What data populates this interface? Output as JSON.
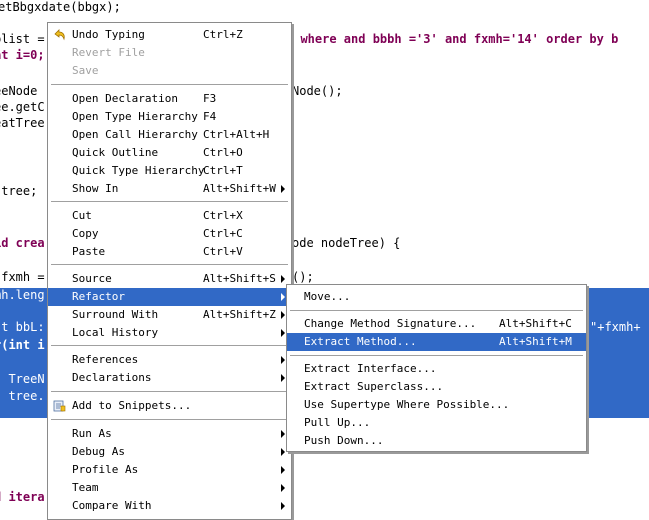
{
  "editor": {
    "lines": [
      {
        "text": "etBbgxdate(bbgx);",
        "sel": false
      },
      {
        "text": "blist = ",
        "sel": false
      },
      {
        "text": "  where and bbbh ='3' and fxmh='14' order by b",
        "sel": false
      },
      {
        "text": "at i=0;",
        "sel": false
      },
      {
        "text": "eeNode",
        "sel": false
      },
      {
        "text": "Node();",
        "sel": false
      },
      {
        "text": "ee.getC",
        "sel": false
      },
      {
        "text": "eatTree",
        "sel": false
      },
      {
        "text": " tree;",
        "sel": false
      },
      {
        "text": "id crea",
        "sel": false
      },
      {
        "text": "ode nodeTree) {",
        "sel": false
      },
      {
        "text": " fxmh =",
        "sel": false
      },
      {
        "text": "();",
        "sel": false
      },
      {
        "text": "mh.leng",
        "sel": true
      },
      {
        "text": "st bbL:",
        "sel": true
      },
      {
        "text": "\"+fxmh+",
        "sel": true
      },
      {
        "text": "r(int i",
        "sel": true
      },
      {
        "text": "  TreeN",
        "sel": true
      },
      {
        "text": "  tree.",
        "sel": true
      },
      {
        "text": "d itera",
        "sel": false
      }
    ]
  },
  "context_menu": {
    "groups": [
      [
        {
          "label": "Undo Typing",
          "accel": "Ctrl+Z",
          "enabled": true,
          "icon": "undo-icon"
        },
        {
          "label": "Revert File",
          "accel": "",
          "enabled": false
        },
        {
          "label": "Save",
          "accel": "",
          "enabled": false
        }
      ],
      [
        {
          "label": "Open Declaration",
          "accel": "F3",
          "enabled": true
        },
        {
          "label": "Open Type Hierarchy",
          "accel": "F4",
          "enabled": true
        },
        {
          "label": "Open Call Hierarchy",
          "accel": "Ctrl+Alt+H",
          "enabled": true
        },
        {
          "label": "Quick Outline",
          "accel": "Ctrl+O",
          "enabled": true
        },
        {
          "label": "Quick Type Hierarchy",
          "accel": "Ctrl+T",
          "enabled": true
        },
        {
          "label": "Show In",
          "accel": "Alt+Shift+W",
          "enabled": true,
          "submenu": true
        }
      ],
      [
        {
          "label": "Cut",
          "accel": "Ctrl+X",
          "enabled": true
        },
        {
          "label": "Copy",
          "accel": "Ctrl+C",
          "enabled": true
        },
        {
          "label": "Paste",
          "accel": "Ctrl+V",
          "enabled": true
        }
      ],
      [
        {
          "label": "Source",
          "accel": "Alt+Shift+S",
          "enabled": true,
          "submenu": true
        },
        {
          "label": "Refactor",
          "accel": "",
          "enabled": true,
          "submenu": true,
          "highlighted": true
        },
        {
          "label": "Surround With",
          "accel": "Alt+Shift+Z",
          "enabled": true,
          "submenu": true
        },
        {
          "label": "Local History",
          "accel": "",
          "enabled": true,
          "submenu": true
        }
      ],
      [
        {
          "label": "References",
          "accel": "",
          "enabled": true,
          "submenu": true
        },
        {
          "label": "Declarations",
          "accel": "",
          "enabled": true,
          "submenu": true
        }
      ],
      [
        {
          "label": "Add to Snippets...",
          "accel": "",
          "enabled": true,
          "icon": "snippet-icon"
        }
      ],
      [
        {
          "label": "Run As",
          "accel": "",
          "enabled": true,
          "submenu": true
        },
        {
          "label": "Debug As",
          "accel": "",
          "enabled": true,
          "submenu": true
        },
        {
          "label": "Profile As",
          "accel": "",
          "enabled": true,
          "submenu": true
        },
        {
          "label": "Team",
          "accel": "",
          "enabled": true,
          "submenu": true
        },
        {
          "label": "Compare With",
          "accel": "",
          "enabled": true,
          "submenu": true
        }
      ]
    ]
  },
  "refactor_submenu": {
    "groups": [
      [
        {
          "label": "Move...",
          "accel": ""
        }
      ],
      [
        {
          "label": "Change Method Signature...",
          "accel": "Alt+Shift+C"
        },
        {
          "label": "Extract Method...",
          "accel": "Alt+Shift+M",
          "highlighted": true
        }
      ],
      [
        {
          "label": "Extract Interface...",
          "accel": ""
        },
        {
          "label": "Extract Superclass...",
          "accel": ""
        },
        {
          "label": "Use Supertype Where Possible...",
          "accel": ""
        },
        {
          "label": "Pull Up...",
          "accel": ""
        },
        {
          "label": "Push Down...",
          "accel": ""
        }
      ]
    ]
  },
  "colors": {
    "selection": "#3169c6",
    "keyword": "#7f0055",
    "string": "#2a00ff"
  }
}
